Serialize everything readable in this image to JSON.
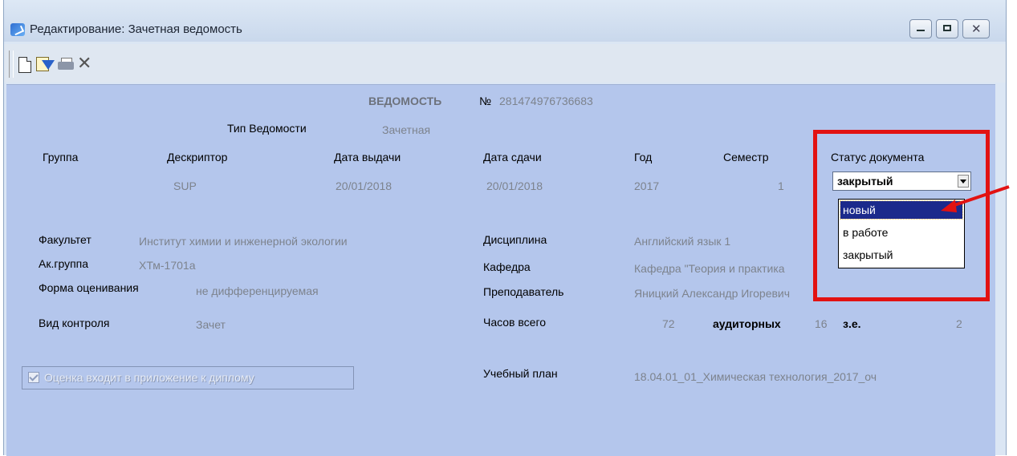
{
  "window": {
    "title": "Редактирование: Зачетная ведомость",
    "minimize_icon": "minimize-icon",
    "maximize_icon": "maximize-icon",
    "close_icon": "close-icon"
  },
  "toolbar": {
    "icons": [
      "new-document-icon",
      "filter-icon",
      "print-icon",
      "delete-icon"
    ],
    "delete_glyph": "✕"
  },
  "sheet": {
    "heading": "ВЕДОМОСТЬ",
    "number_label": "№",
    "number": "281474976736683",
    "type_label": "Тип Ведомости",
    "type_value": "Зачетная"
  },
  "columns": {
    "group": {
      "label": "Группа",
      "value": ""
    },
    "descriptor": {
      "label": "Дескриптор",
      "value": "SUP"
    },
    "issue_date": {
      "label": "Дата выдачи",
      "value": "20/01/2018"
    },
    "due_date": {
      "label": "Дата сдачи",
      "value": "20/01/2018"
    },
    "year": {
      "label": "Год",
      "value": "2017"
    },
    "semester": {
      "label": "Семестр",
      "value": "1"
    },
    "status": {
      "label": "Статус документа",
      "value": "закрытый"
    }
  },
  "status_dropdown": {
    "options": [
      "новый",
      "в работе",
      "закрытый"
    ],
    "highlighted": "новый"
  },
  "left_fields": {
    "faculty": {
      "label": "Факультет",
      "value": "Институт химии и инженерной экологии"
    },
    "acgroup": {
      "label": "Ак.группа",
      "value": "ХТм-1701а"
    },
    "assessment": {
      "label": "Форма оценивания",
      "value": "не дифференцируемая"
    },
    "control": {
      "label": "Вид контроля",
      "value": "Зачет"
    }
  },
  "right_fields": {
    "discipline": {
      "label": "Дисциплина",
      "value": "Английский язык 1"
    },
    "department": {
      "label": "Кафедра",
      "value": "Кафедра \"Теория и практика"
    },
    "teacher": {
      "label": "Преподаватель",
      "value": "Яницкий Александр Игоревич"
    },
    "hours": {
      "label": "Часов всего",
      "value": "72",
      "aud_label": "аудиторных",
      "aud_value": "16",
      "ze_label": "з.е.",
      "ze_value": "2"
    },
    "plan": {
      "label": "Учебный план",
      "value": "18.04.01_01_Химическая технология_2017_оч"
    }
  },
  "diploma_checkbox": {
    "label": "Оценка входит в приложение к диплому",
    "checked": true
  },
  "colors": {
    "form_bg": "#b4c6ec",
    "value_text": "#7d838d",
    "highlight": "#e21212",
    "selected_option": "#1b2a8c"
  }
}
